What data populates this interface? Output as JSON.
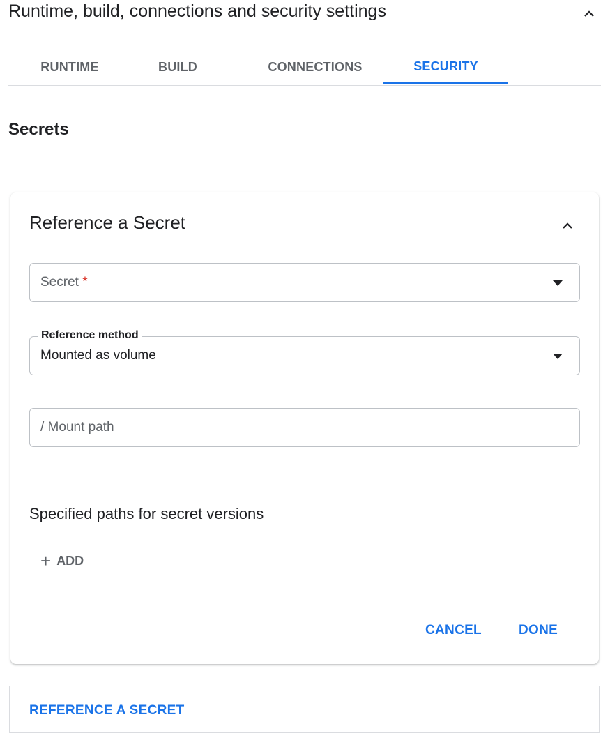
{
  "section": {
    "title": "Runtime, build, connections and security settings",
    "collapse_icon": "chevron-up-icon"
  },
  "tabs": [
    {
      "label": "RUNTIME",
      "active": false
    },
    {
      "label": "BUILD",
      "active": false
    },
    {
      "label": "CONNECTIONS",
      "active": false
    },
    {
      "label": "SECURITY",
      "active": true
    }
  ],
  "secrets": {
    "heading": "Secrets",
    "card": {
      "title": "Reference a Secret",
      "collapse_icon": "chevron-up-icon",
      "secret_field": {
        "label": "Secret",
        "required_mark": "*",
        "value": ""
      },
      "reference_method": {
        "label": "Reference method",
        "value": "Mounted as volume"
      },
      "mount_path": {
        "placeholder": "/ Mount path",
        "value": ""
      },
      "paths_heading": "Specified paths for secret versions",
      "add_label": "ADD",
      "cancel_label": "CANCEL",
      "done_label": "DONE"
    },
    "reference_button_label": "REFERENCE A SECRET"
  },
  "colors": {
    "accent": "#1a73e8",
    "required": "#d93025"
  }
}
